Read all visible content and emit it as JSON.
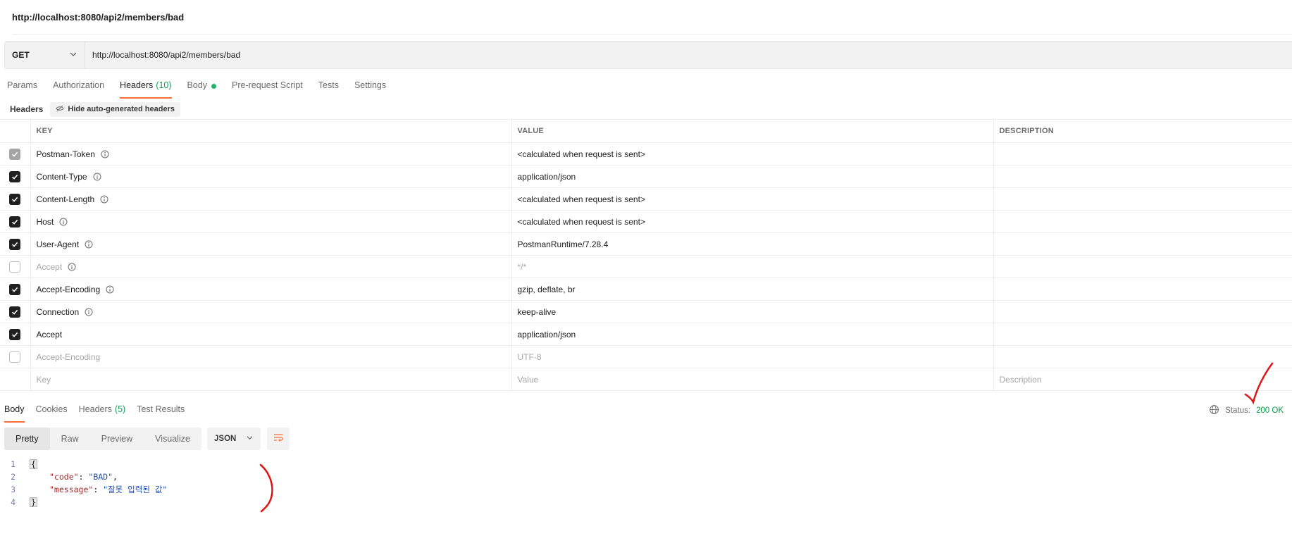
{
  "request": {
    "title": "http://localhost:8080/api2/members/bad",
    "method": "GET",
    "url": "http://localhost:8080/api2/members/bad"
  },
  "tabs": {
    "params": "Params",
    "authorization": "Authorization",
    "headers": "Headers",
    "headers_count": "(10)",
    "body": "Body",
    "prerequest": "Pre-request Script",
    "tests": "Tests",
    "settings": "Settings"
  },
  "headers_section": {
    "label": "Headers",
    "hide_button": "Hide auto-generated headers",
    "columns": {
      "key": "KEY",
      "value": "VALUE",
      "description": "DESCRIPTION"
    },
    "rows": [
      {
        "key": "Postman-Token",
        "value": "<calculated when request is sent>",
        "state": "locked"
      },
      {
        "key": "Content-Type",
        "value": "application/json",
        "state": "checked"
      },
      {
        "key": "Content-Length",
        "value": "<calculated when request is sent>",
        "state": "checked"
      },
      {
        "key": "Host",
        "value": "<calculated when request is sent>",
        "state": "checked"
      },
      {
        "key": "User-Agent",
        "value": "PostmanRuntime/7.28.4",
        "state": "checked"
      },
      {
        "key": "Accept",
        "value": "*/*",
        "state": "unchecked"
      },
      {
        "key": "Accept-Encoding",
        "value": "gzip, deflate, br",
        "state": "checked"
      },
      {
        "key": "Connection",
        "value": "keep-alive",
        "state": "checked"
      },
      {
        "key": "Accept",
        "value": "application/json",
        "state": "checked"
      },
      {
        "key": "Accept-Encoding",
        "value": "UTF-8",
        "state": "unchecked"
      }
    ],
    "placeholders": {
      "key": "Key",
      "value": "Value",
      "description": "Description"
    }
  },
  "response": {
    "tabs": {
      "body": "Body",
      "cookies": "Cookies",
      "headers": "Headers",
      "headers_count": "(5)",
      "test_results": "Test Results"
    },
    "status_label": "Status:",
    "status_value": "200 OK",
    "views": {
      "pretty": "Pretty",
      "raw": "Raw",
      "preview": "Preview",
      "visualize": "Visualize"
    },
    "format": "JSON",
    "lines": [
      "1",
      "2",
      "3",
      "4"
    ],
    "json": {
      "open": "{",
      "close": "}",
      "code_key": "\"code\"",
      "code_value": "\"BAD\"",
      "message_key": "\"message\"",
      "message_value": "\"잘못 입력된 값\""
    }
  },
  "colors": {
    "accent": "#ff6c37",
    "status_ok": "#0a9a4a",
    "annotation": "#e01414"
  }
}
